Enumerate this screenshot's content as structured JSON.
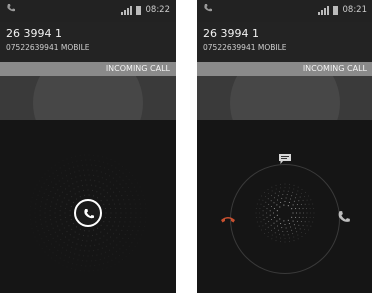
{
  "screens": [
    {
      "status_time": "08:22",
      "caller_name": "26 3994 1",
      "caller_number_type": "07522639941  MOBILE",
      "incoming_label": "INCOMING CALL",
      "answer_icon": "phone-handset-icon"
    },
    {
      "status_time": "08:21",
      "caller_name": "26 3994 1",
      "caller_number_type": "07522639941  MOBILE",
      "incoming_label": "INCOMING CALL",
      "actions": {
        "message_icon": "message-icon",
        "decline_icon": "phone-hangup-icon",
        "answer_icon": "phone-answer-icon"
      }
    }
  ],
  "colors": {
    "background": "#181818",
    "incoming_bar": "#8a8a8a",
    "decline": "#c9502f",
    "answer": "#bdbdbd"
  }
}
